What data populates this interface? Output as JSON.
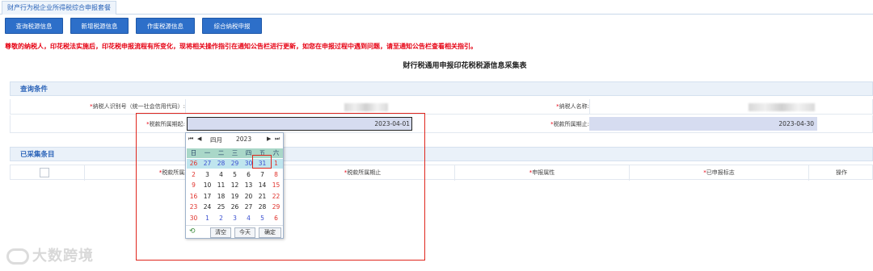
{
  "tabs": [
    {
      "label": "财产行为税企业所得税综合申报套餐"
    }
  ],
  "toolbar": {
    "buttons": [
      {
        "label": "查询税源信息"
      },
      {
        "label": "新增税源信息"
      },
      {
        "label": "作废税源信息"
      },
      {
        "label": "综合纳税申报"
      }
    ]
  },
  "notice": "尊敬的纳税人，印花税法实施后，印花税申报流程有所变化，现将相关操作指引在通知公告栏进行更新，如您在申报过程中遇到问题，请至通知公告栏查看相关指引。",
  "form_title": "财行税通用申报印花税税源信息采集表",
  "query_section": {
    "title": "查询条件",
    "taxpayer_id_label": "纳税人识别号（统一社会信用代码）:",
    "taxpayer_name_label": "纳税人名称:",
    "period_start_label": "税款所属期起:",
    "period_start_value": "2023-04-01",
    "period_end_label": "税款所属期止:",
    "period_end_value": "2023-04-30"
  },
  "collected_section": {
    "title": "已采集条目",
    "columns": [
      "税款所属期起",
      "税款所属期止",
      "申报属性",
      "已申报标志",
      "操作"
    ]
  },
  "calendar": {
    "month": "四月",
    "year": "2023",
    "weekdays": [
      "日",
      "一",
      "二",
      "三",
      "四",
      "五",
      "六"
    ],
    "weeks": [
      [
        "26",
        "27",
        "28",
        "29",
        "30",
        "31",
        "1"
      ],
      [
        "2",
        "3",
        "4",
        "5",
        "6",
        "7",
        "8"
      ],
      [
        "9",
        "10",
        "11",
        "12",
        "13",
        "14",
        "15"
      ],
      [
        "16",
        "17",
        "18",
        "19",
        "20",
        "21",
        "22"
      ],
      [
        "23",
        "24",
        "25",
        "26",
        "27",
        "28",
        "29"
      ],
      [
        "30",
        "1",
        "2",
        "3",
        "4",
        "5",
        "6"
      ]
    ],
    "buttons": {
      "clear": "清空",
      "today": "今天",
      "ok": "确定"
    }
  },
  "watermark": "大数跨境",
  "colors": {
    "primary": "#2d6fc9",
    "notice": "#e60012",
    "highlight": "#e0261d"
  }
}
